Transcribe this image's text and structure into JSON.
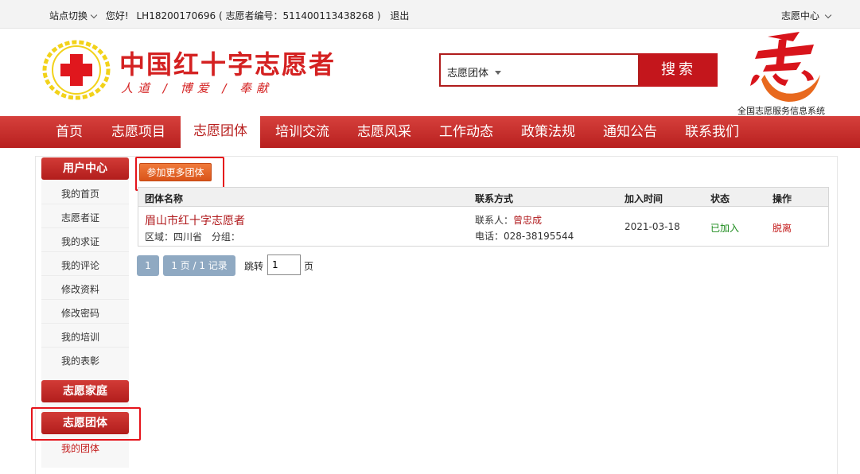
{
  "topbar": {
    "site_switch": "站点切换",
    "greeting": "您好!",
    "user": "LH18200170696",
    "volunteer_no": "( 志愿者编号：511400113438268 )",
    "logout": "退出",
    "center": "志愿中心"
  },
  "header": {
    "title": "中国红十字志愿者",
    "slogan": "人道 / 博爱 / 奉献",
    "search_category": "志愿团体",
    "search_button": "搜索",
    "system_name": "全国志愿服务信息系统"
  },
  "nav": {
    "items": [
      "首页",
      "志愿项目",
      "志愿团体",
      "培训交流",
      "志愿风采",
      "工作动态",
      "政策法规",
      "通知公告",
      "联系我们"
    ],
    "active": "志愿团体"
  },
  "sidebar": {
    "user_center": "用户中心",
    "items": [
      "我的首页",
      "志愿者证",
      "我的求证",
      "我的评论",
      "修改资料",
      "修改密码",
      "我的培训",
      "我的表彰"
    ],
    "family": "志愿家庭",
    "groups": "志愿团体",
    "my_groups": "我的团体"
  },
  "main": {
    "join_more": "参加更多团体",
    "columns": [
      "团体名称",
      "联系方式",
      "加入时间",
      "状态",
      "操作"
    ],
    "row": {
      "name": "眉山市红十字志愿者",
      "region": "区域：四川省",
      "subgroup": "分组：",
      "contact_label": "联系人：",
      "contact_name": "曾忠成",
      "phone": "电话：028-38195544",
      "joined": "2021-03-18",
      "status": "已加入",
      "action": "脱离"
    },
    "pagination": {
      "page": "1",
      "summary": "1 页 / 1 记录",
      "jump_label": "跳转",
      "jump_value": "1",
      "page_suffix": "页"
    }
  },
  "colors": {
    "brand_red": "#c4161c",
    "status_green": "#1a8a1a",
    "highlight": "#e5141b"
  }
}
